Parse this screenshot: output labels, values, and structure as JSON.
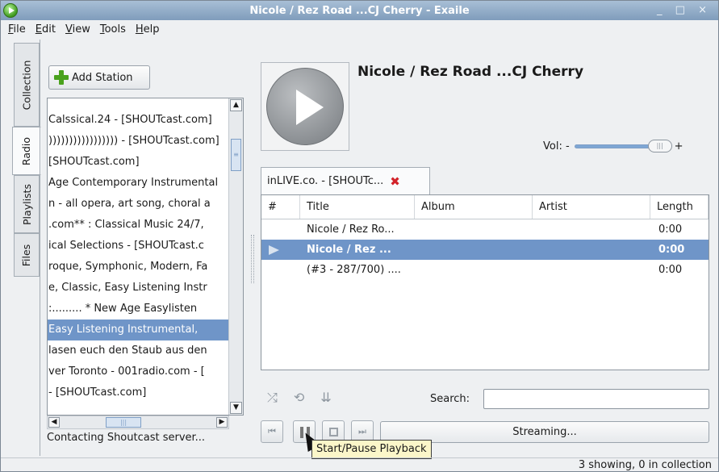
{
  "window": {
    "title": "Nicole / Rez Road  ...CJ Cherry - Exaile",
    "controls": "_ □ ×"
  },
  "menu": [
    "File",
    "Edit",
    "View",
    "Tools",
    "Help"
  ],
  "side_tabs": [
    "Collection",
    "Radio",
    "Playlists",
    "Files"
  ],
  "active_side_tab": "Radio",
  "radio": {
    "add_station_label": "Add Station",
    "stations": [
      "Calssical.24 - [SHOUTcast.com]",
      "))))))))))))))))) - [SHOUTcast.com]",
      "[SHOUTcast.com]",
      "Age Contemporary Instrumental",
      "n - all opera, art song, choral a",
      ".com** : Classical Music 24/7,",
      "ical Selections - [SHOUTcast.c",
      "roque, Symphonic, Modern, Fa",
      "e, Classic, Easy Listening Instr",
      ":......... * New Age Easylisten",
      "Easy Listening Instrumental,",
      "lasen euch den Staub aus den",
      "ver Toronto - 001radio.com - [",
      "- [SHOUTcast.com]"
    ],
    "selected_index": 10,
    "status": "Contacting Shoutcast server..."
  },
  "now_playing": {
    "heading": "Nicole / Rez Road  ...CJ Cherry",
    "volume_label": "Vol: -",
    "volume_plus": "+",
    "volume_level": 0.8
  },
  "playlist_tab": {
    "label": "inLIVE.co. - [SHOUTc...",
    "close_icon": "close-icon"
  },
  "tracklist": {
    "columns": [
      "#",
      "Title",
      "Album",
      "Artist",
      "Length"
    ],
    "rows": [
      {
        "num": "",
        "title": "Nicole / Rez Ro...",
        "album": "",
        "artist": "",
        "length": "0:00"
      },
      {
        "num": "",
        "title": "Nicole / Rez ...",
        "album": "",
        "artist": "",
        "length": "0:00"
      },
      {
        "num": "",
        "title": "(#3 - 287/700) ....",
        "album": "",
        "artist": "",
        "length": "0:00"
      }
    ],
    "playing_index": 1
  },
  "controls": {
    "icons": [
      "shuffle-icon",
      "repeat-icon",
      "dynamic-icon"
    ],
    "search_label": "Search:",
    "search_value": "",
    "buttons": [
      "prev-icon",
      "pause-icon",
      "stop-icon",
      "next-icon"
    ],
    "progress_text": "Streaming...",
    "tooltip": "Start/Pause Playback"
  },
  "statusbar": {
    "text": "3 showing, 0 in collection"
  }
}
